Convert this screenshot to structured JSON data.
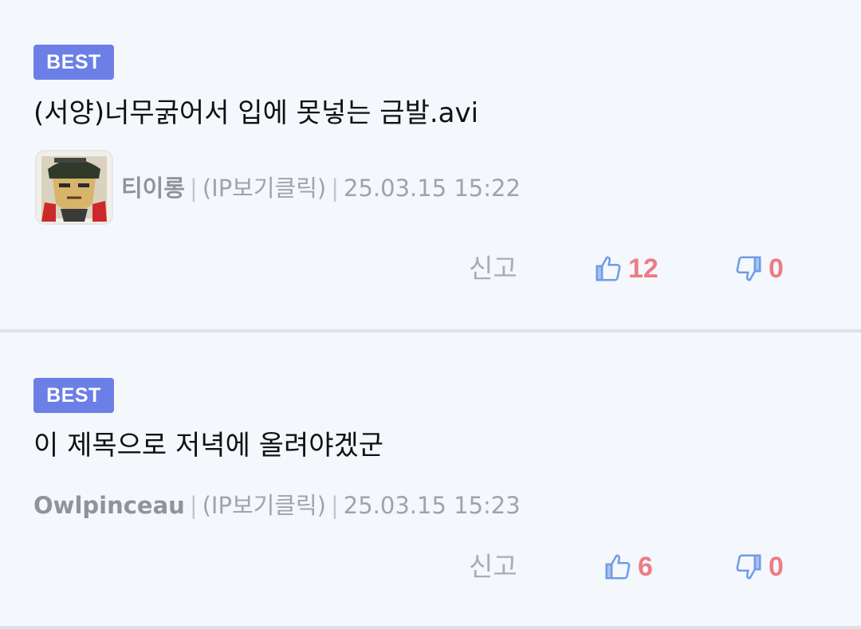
{
  "comments": [
    {
      "badge": "BEST",
      "title": "(서양)너무굵어서 입에 못넣는 금발.avi",
      "author": "티이롱",
      "ip": "(IP보기클릭)",
      "datetime": "25.03.15 15:22",
      "report": "신고",
      "likes": "12",
      "dislikes": "0",
      "has_avatar": true
    },
    {
      "badge": "BEST",
      "title": "이 제목으로 저녁에 올려야겠군",
      "author": "Owlpinceau",
      "ip": "(IP보기클릭)",
      "datetime": "25.03.15 15:23",
      "report": "신고",
      "likes": "6",
      "dislikes": "0",
      "has_avatar": false
    }
  ],
  "separator": "|",
  "colors": {
    "badge_bg": "#6b7fe6",
    "count": "#ec7d84",
    "thumb_icon": "#6f9ce6",
    "background": "#f4f7fc"
  },
  "icons": {
    "like": "thumbs-up-icon",
    "dislike": "thumbs-down-icon",
    "avatar": "user-avatar-image"
  }
}
